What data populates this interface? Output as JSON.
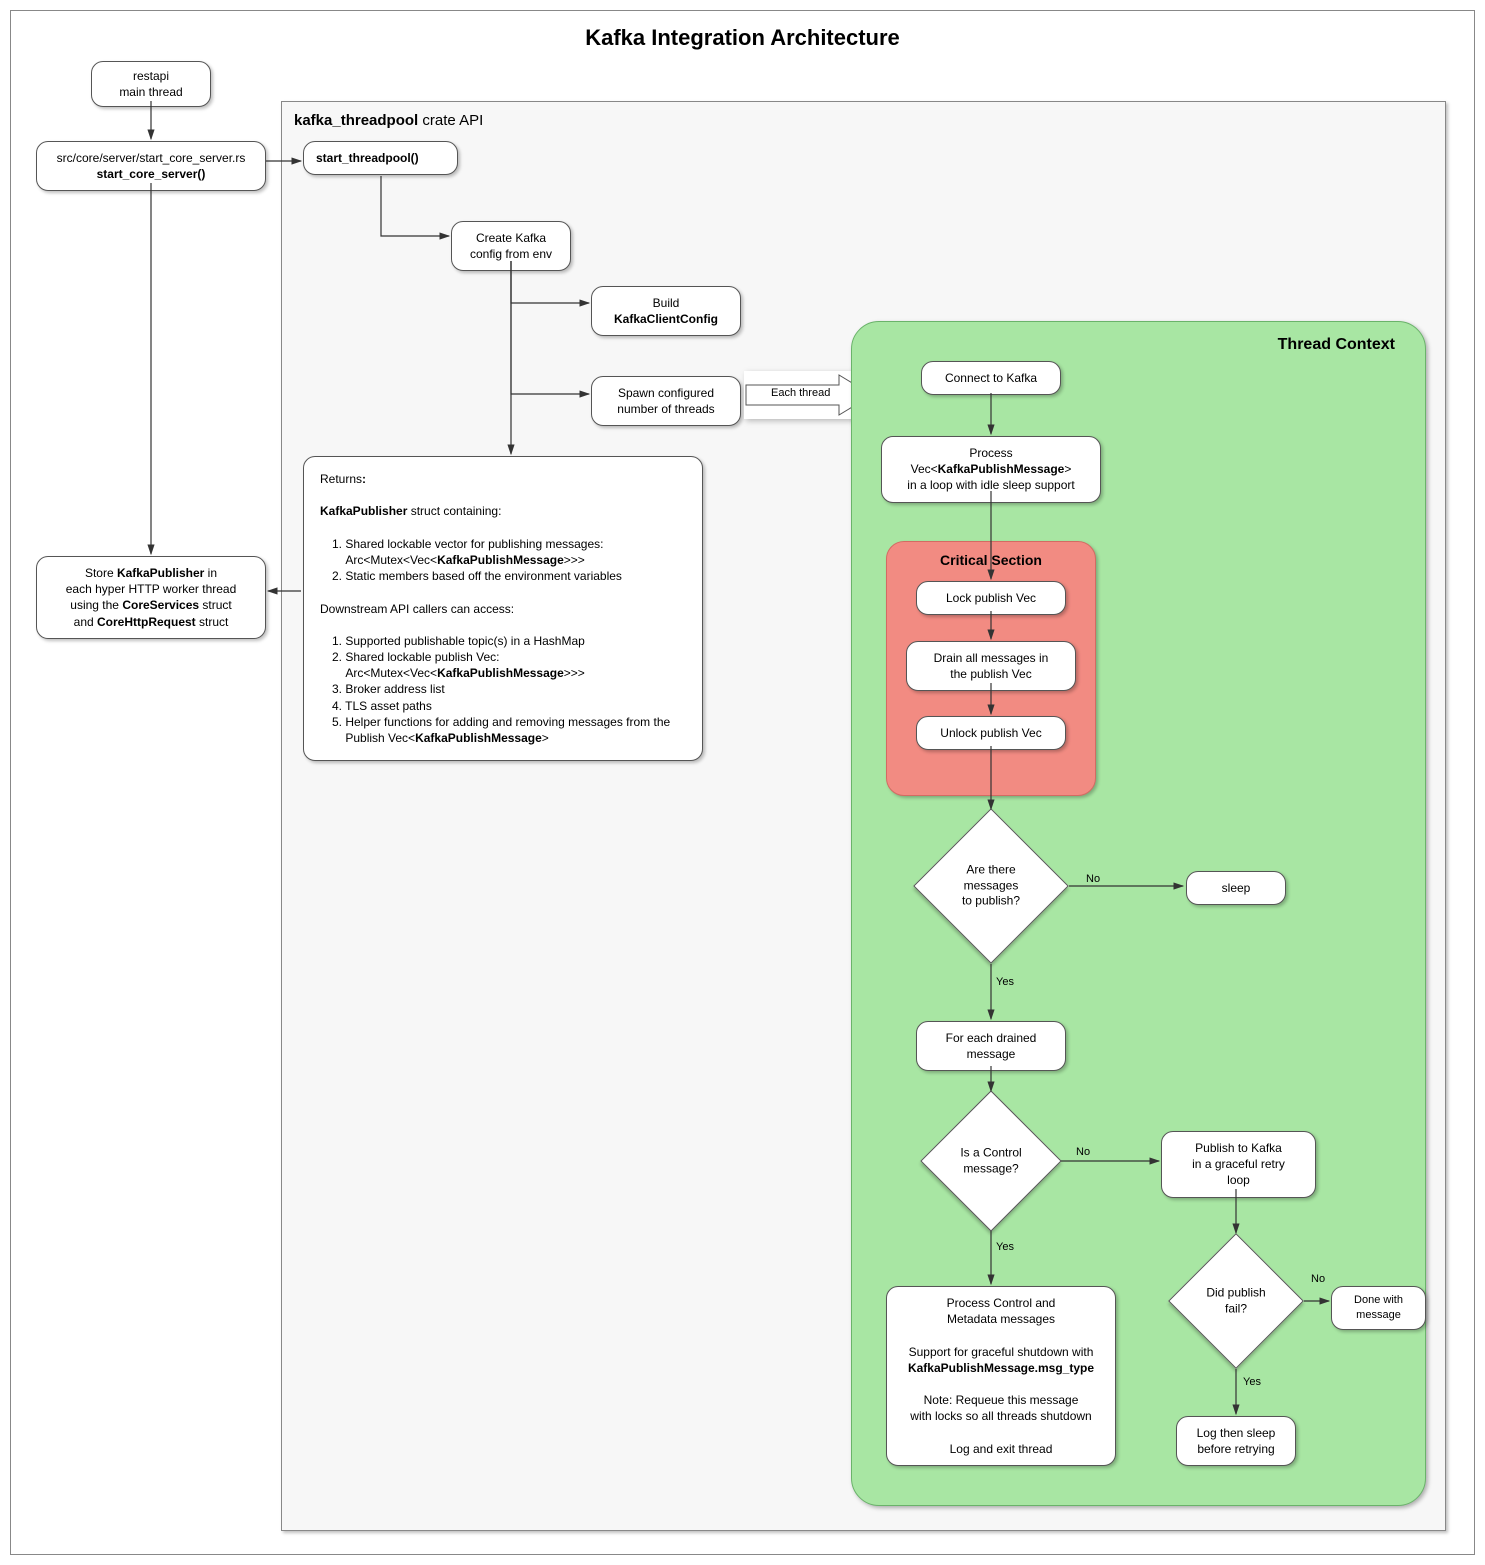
{
  "title": "Kafka Integration Architecture",
  "containers": {
    "crate_api_label": "kafka_threadpool",
    "crate_api_suffix": " crate API",
    "thread_context_label": "Thread Context",
    "critical_section_label": "Critical Section"
  },
  "nodes": {
    "restapi": {
      "line1": "restapi",
      "line2": "main thread"
    },
    "start_core": {
      "line1": "src/core/server/start_core_server.rs",
      "line2": "start_core_server()"
    },
    "store_publisher": {
      "pre": "Store ",
      "kp": "KafkaPublisher",
      "mid1": " in",
      "l2": "each hyper HTTP worker thread",
      "l3a": "using the ",
      "l3b": "CoreServices",
      "l3c": " struct",
      "l4a": "and ",
      "l4b": "CoreHttpRequest",
      "l4c": " struct"
    },
    "start_threadpool": "start_threadpool()",
    "create_kafka_cfg": {
      "l1": "Create Kafka",
      "l2": "config from env"
    },
    "build_kcc": {
      "l1": "Build",
      "l2": "KafkaClientConfig"
    },
    "spawn_threads": {
      "l1": "Spawn configured",
      "l2": "number of threads"
    },
    "returns": {
      "heading": "Returns:",
      "kp_line": " struct containing:",
      "kp": "KafkaPublisher",
      "item1a": "Shared lockable vector for publishing messages:",
      "item1b": "Arc<Mutex<Vec<",
      "item1c": "KafkaPublishMessage",
      "item1d": ">>>",
      "item2": "Static members based off the environment variables",
      "heading2": "Downstream API callers can access:",
      "d1": "Supported publishable topic(s) in a HashMap",
      "d2a": "Shared lockable publish Vec:",
      "d2b": "Arc<Mutex<Vec<",
      "d2c": "KafkaPublishMessage",
      "d2d": ">>>",
      "d3": "Broker address list",
      "d4": "TLS asset paths",
      "d5a": "Helper functions for adding and removing messages from the",
      "d5b": "Publish Vec<",
      "d5c": "KafkaPublishMessage",
      "d5d": ">"
    },
    "each_thread_label": "Each thread",
    "connect_kafka": "Connect to Kafka",
    "process_loop": {
      "l1": "Process",
      "l2a": "Vec<",
      "l2b": "KafkaPublishMessage",
      "l2c": ">",
      "l3": "in a loop with idle sleep support"
    },
    "lock_vec": "Lock publish Vec",
    "drain_vec": {
      "l1": "Drain all messages in",
      "l2": "the publish Vec"
    },
    "unlock_vec": "Unlock publish Vec",
    "decide_messages": {
      "l1": "Are there",
      "l2": "messages",
      "l3": "to publish?"
    },
    "sleep": "sleep",
    "for_each_drained": {
      "l1": "For each drained",
      "l2": "message"
    },
    "is_control": {
      "l1": "Is a Control",
      "l2": "message?"
    },
    "publish_kafka": {
      "l1": "Publish to Kafka",
      "l2": "in a graceful retry",
      "l3": "loop"
    },
    "did_fail": {
      "l1": "Did publish",
      "l2": "fail?"
    },
    "done_msg": "Done with message",
    "log_retry": {
      "l1": "Log then sleep",
      "l2": "before retrying"
    },
    "process_control": {
      "l1": "Process Control and",
      "l2": "Metadata messages",
      "l3": "Support for graceful shutdown with",
      "l4": "KafkaPublishMessage.msg_type",
      "l5": "Note: Requeue this message",
      "l6": "with locks so all threads shutdown",
      "l7": "Log and exit thread"
    }
  },
  "edge_labels": {
    "yes": "Yes",
    "no": "No"
  }
}
